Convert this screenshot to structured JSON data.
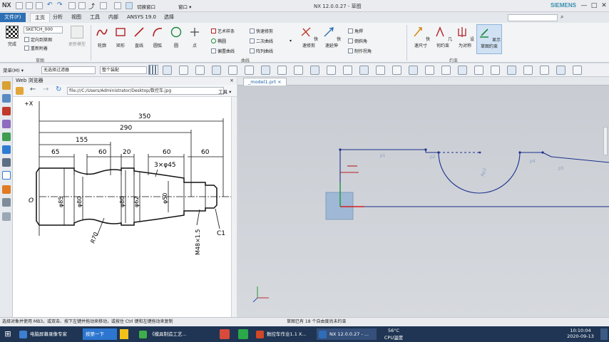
{
  "app": {
    "logo": "NX",
    "title": "NX 12.0.0.27 - 草图",
    "brand": "SIEMENS",
    "win_min": "—",
    "win_max": "□",
    "win_close": "✕",
    "quick_window": "窗口 ▾",
    "quick_switch": "切换窗口"
  },
  "tabs": [
    {
      "label": "文件(F)"
    },
    {
      "label": "主页"
    },
    {
      "label": "分析"
    },
    {
      "label": "视图"
    },
    {
      "label": "工具"
    },
    {
      "label": "内部"
    },
    {
      "label": "ANSYS 19.0"
    },
    {
      "label": "选择"
    }
  ],
  "ribbon": {
    "sketch_name": "SKETCH_000",
    "finish": "完成",
    "rename": "定向到草图",
    "reattach": "重新附着",
    "update_model": "更新模型",
    "group_sketch": "草图",
    "curve_items": [
      "轮廓",
      "矩形",
      "直线",
      "圆弧",
      "圆",
      "点"
    ],
    "curve_small": [
      "艺术样条",
      "椭圆",
      "偏置曲线",
      "快速修剪",
      "二次曲线",
      "阵列曲线"
    ],
    "edit_items": [
      "快速修剪",
      "快速延伸"
    ],
    "fillet_items": [
      "角焊",
      "倒斜角",
      "制作拐角"
    ],
    "group_curve": "曲线",
    "constraint_items": [
      "快速尺寸",
      "几何约束",
      "设为对称",
      "显示草图约束"
    ],
    "group_constraint": "约束"
  },
  "toolbar2": {
    "menu": "菜单(M) ▾",
    "filter": "无选择过滤器",
    "scope": "整个装配"
  },
  "web_panel": {
    "title": "Web 浏览器",
    "url": "file:///C:/Users/Administrator/Desktop/数控车.jpg",
    "tools": "工具 ▾"
  },
  "drawing": {
    "x_label": "+X",
    "origin": "O",
    "dims_top": [
      "350",
      "290",
      "155"
    ],
    "dims_segments": [
      "65",
      "60",
      "20",
      "60",
      "60"
    ],
    "chamfer_note": "3×φ45",
    "diameters": [
      "φ85",
      "φ80",
      "φ80",
      "φ62",
      "φ50"
    ],
    "radius": "R70",
    "thread": "M48×1.5",
    "c1": "C1"
  },
  "graphics": {
    "tab": "_model1.prt"
  },
  "status": {
    "left": "选择对象并使用 MB3，或双击、按下左键并拖动来移动，或按住 Ctrl 键和左键拖动来复制",
    "center": "草图已有 18 个自由度尚未约束"
  },
  "taskbar": {
    "start": "⊞",
    "items": [
      {
        "label": "电脑屏幕录像专家"
      },
      {
        "label": "按第一下"
      },
      {
        "label": "《模具制造工艺..."
      },
      {
        "label": "数控车作业1.1 X..."
      },
      {
        "label": "NX 12.0.0.27 - ..."
      }
    ],
    "weather": "56°C",
    "weather_sub": "CPU温度",
    "time": "10:10:04",
    "date": "2020-09-13"
  },
  "colors": {
    "accent": "#2d6fb3",
    "sketch_line": "#1b2f8a",
    "taskbar": "#1f3553"
  }
}
